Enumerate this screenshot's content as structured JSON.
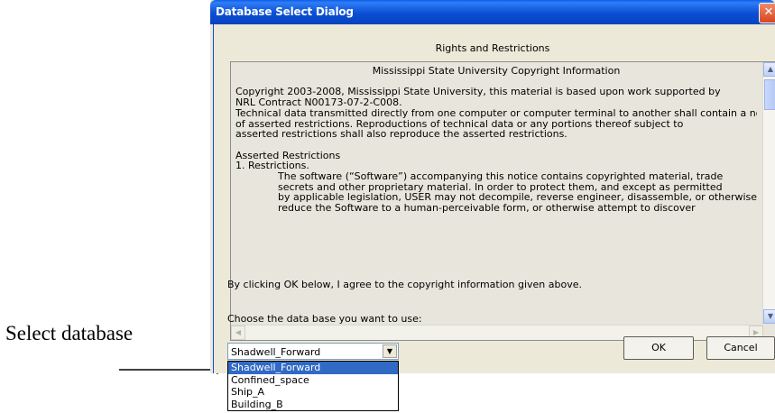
{
  "annotation": {
    "label": "Select database"
  },
  "dialog": {
    "title": "Database Select Dialog",
    "close_icon": "close-icon",
    "rights_heading": "Rights and Restrictions",
    "textbox": {
      "lines": [
        {
          "text": "Mississippi State University Copyright Information",
          "style": "center"
        },
        {
          "text": "",
          "style": "blank"
        },
        {
          "text": "Copyright 2003-2008, Mississippi State University, this material is based upon work supported by",
          "style": ""
        },
        {
          "text": "NRL Contract N00173-07-2-C008.",
          "style": ""
        },
        {
          "text": "Technical data transmitted directly from one computer or computer terminal to another shall contain a notice",
          "style": ""
        },
        {
          "text": "of asserted restrictions. Reproductions of technical data or any portions thereof subject to",
          "style": ""
        },
        {
          "text": "asserted restrictions shall also reproduce the asserted restrictions.",
          "style": ""
        },
        {
          "text": "",
          "style": "blank"
        },
        {
          "text": "Asserted Restrictions",
          "style": ""
        },
        {
          "text": "1. Restrictions.",
          "style": ""
        },
        {
          "text": "The software (“Software”) accompanying this notice contains copyrighted material, trade",
          "style": "indent"
        },
        {
          "text": "secrets and other proprietary material. In order to protect them, and except as permitted",
          "style": "indent"
        },
        {
          "text": "by applicable legislation, USER may not decompile, reverse engineer, disassemble, or otherwise",
          "style": "indent"
        },
        {
          "text": "reduce the Software to a human-perceivable form, or otherwise attempt to discover",
          "style": "indent"
        }
      ]
    },
    "agree_text": "By clicking OK below, I agree to the copyright information given above.",
    "choose_label": "Choose the data base you want to use:",
    "combo": {
      "selected": "Shadwell_Forward"
    },
    "ok_label": "OK",
    "cancel_label": "Cancel"
  },
  "dropdown": {
    "options": [
      "Shadwell_Forward",
      "Confined_space",
      "Ship_A",
      "Building_B"
    ],
    "highlighted": "Shadwell_Forward"
  }
}
